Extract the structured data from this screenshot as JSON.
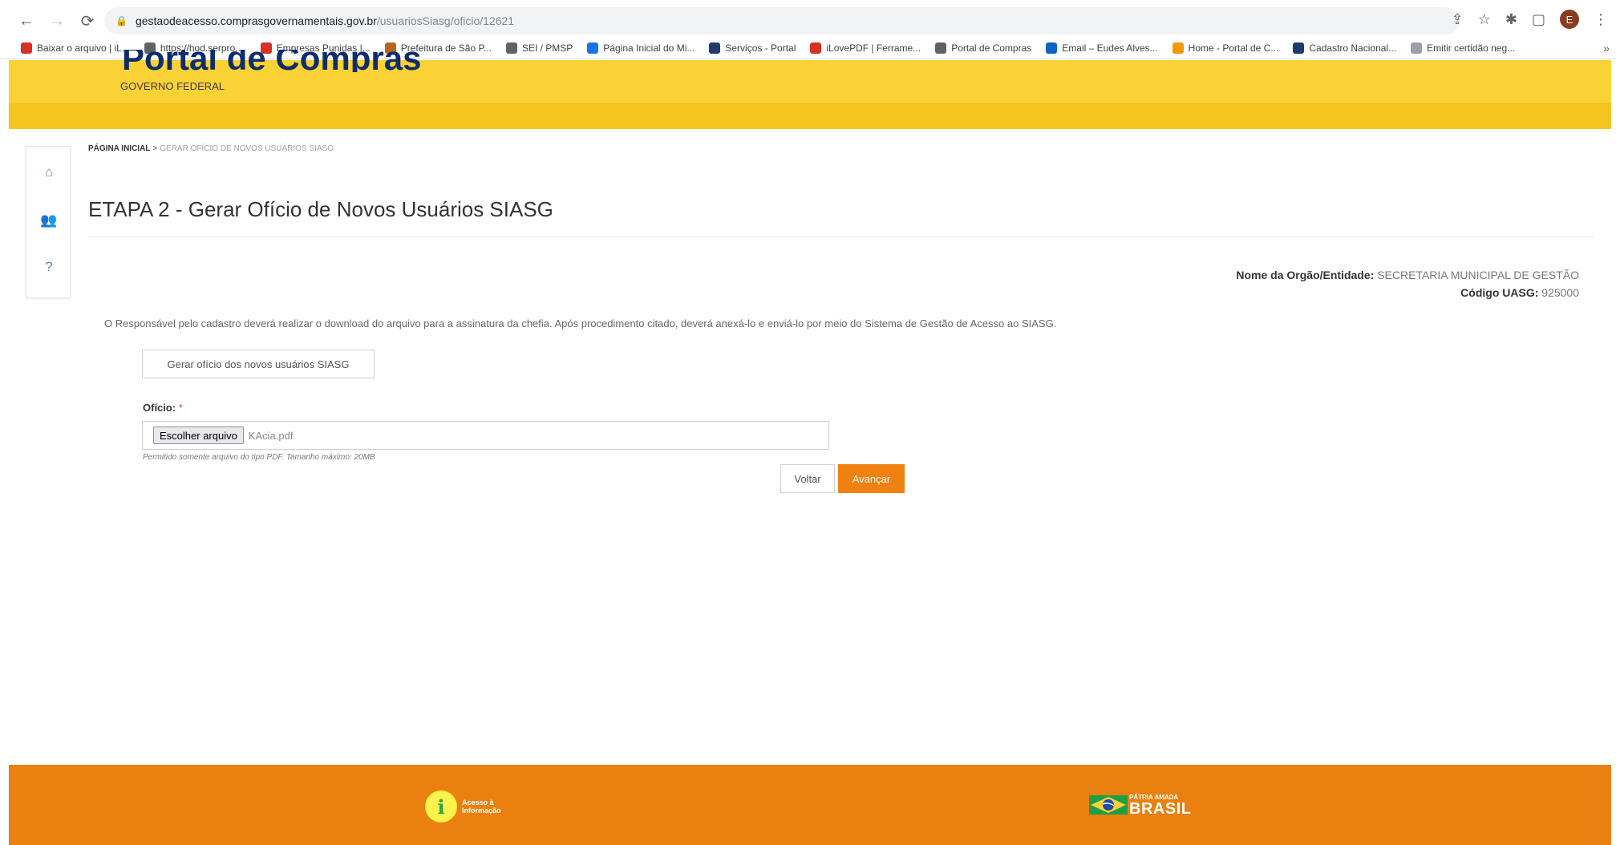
{
  "browser": {
    "url_host": "gestaodeacesso.comprasgovernamentais.gov.br",
    "url_path": "/usuariosSiasg/oficio/12621",
    "profile_initial": "E",
    "bookmarks": [
      {
        "label": "Baixar o arquivo | iL...",
        "color": "#d93025"
      },
      {
        "label": "https://hod.serpro....",
        "color": "#5f6368"
      },
      {
        "label": "Empresas Punidas |...",
        "color": "#d93025"
      },
      {
        "label": "Prefeitura de São P...",
        "color": "#b5651d"
      },
      {
        "label": "SEI / PMSP",
        "color": "#5f6368"
      },
      {
        "label": "Página Inicial do Mi...",
        "color": "#1a73e8"
      },
      {
        "label": "Serviços - Portal",
        "color": "#1f3b6e"
      },
      {
        "label": "iLovePDF | Ferrame...",
        "color": "#d93025"
      },
      {
        "label": "Portal de Compras",
        "color": "#5f6368"
      },
      {
        "label": "Email – Eudes Alves...",
        "color": "#0a64c8"
      },
      {
        "label": "Home - Portal de C...",
        "color": "#f29900"
      },
      {
        "label": "Cadastro Nacional...",
        "color": "#1f3b6e"
      },
      {
        "label": "Emitir certidão neg...",
        "color": "#9aa0a6"
      }
    ]
  },
  "header": {
    "title": "Portal de Compras",
    "subtitle": "GOVERNO FEDERAL"
  },
  "breadcrumb": {
    "home": "PÁGINA INICIAL",
    "separator": ">",
    "current": "GERAR OFÍCIO DE NOVOS USUÁRIOS SIASG"
  },
  "page": {
    "title": "ETAPA 2 - Gerar Ofício de Novos Usuários SIASG",
    "org_label": "Nome da Orgão/Entidade:",
    "org_value": "SECRETARIA MUNICIPAL DE GESTÃO",
    "uasg_label": "Código UASG:",
    "uasg_value": "925000",
    "instructions": "O Responsável pelo cadastro deverá realizar o download do arquivo para a assinatura da chefia. Após procedimento citado, deverá anexá-lo e enviá-lo por meio do Sistema de Gestão de Acesso ao SIASG.",
    "generate_button": "Gerar ofício dos novos usuários SIASG",
    "field_label": "Ofício:",
    "required_mark": "*",
    "file_button": "Escolher arquivo",
    "file_name": "KAcia.pdf",
    "hint": "Permitido somente arquivo do tipo PDF. Tamanho máximo: 20MB",
    "back_button": "Voltar",
    "next_button": "Avançar"
  },
  "footer": {
    "access_info_line1": "Acesso à",
    "access_info_line2": "Informação",
    "brasil_small": "PÁTRIA AMADA",
    "brasil_big": "BRASIL"
  },
  "colors": {
    "header_yellow": "#fbd235",
    "accent_orange": "#f0800f",
    "footer_orange": "#e9800f",
    "brand_blue": "#0f2d6b"
  }
}
